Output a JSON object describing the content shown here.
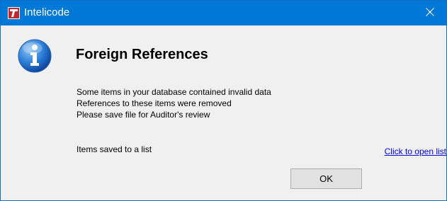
{
  "window": {
    "title": "Intelicode",
    "app_icon": "intelicode-t-logo",
    "close_icon": "close-icon",
    "titlebar_color": "#0078d7"
  },
  "dialog": {
    "icon": "info-icon",
    "heading": "Foreign References",
    "messages": [
      "Some items in your database contained invalid data",
      "References to these items were removed",
      "Please save file for Auditor's review"
    ],
    "saved_text": "Items saved to a list",
    "link_text": "Click to open list",
    "ok_label": "OK"
  }
}
